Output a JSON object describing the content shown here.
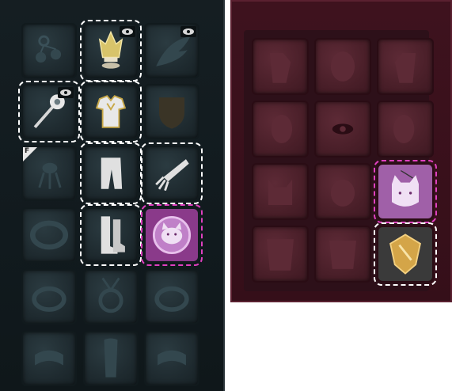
{
  "left_inventory": {
    "theme": "teal-stone",
    "slots": [
      {
        "id": "earring",
        "icon": "earring-icon",
        "state": "empty"
      },
      {
        "id": "crown",
        "icon": "crown-icon",
        "state": "equipped",
        "badge": "eye-icon"
      },
      {
        "id": "wing",
        "icon": "wing-icon",
        "state": "empty",
        "badge": "eye-icon"
      },
      {
        "id": "staff",
        "icon": "staff-icon",
        "state": "equipped",
        "badge": "eye-icon"
      },
      {
        "id": "armor",
        "icon": "armor-icon",
        "state": "equipped"
      },
      {
        "id": "shield",
        "icon": "shield-icon",
        "state": "empty"
      },
      {
        "id": "tool",
        "icon": "tool-icon",
        "state": "empty",
        "badge_text": "F"
      },
      {
        "id": "pants",
        "icon": "pants-icon",
        "state": "equipped"
      },
      {
        "id": "gauntlet",
        "icon": "gauntlet-icon",
        "state": "equipped"
      },
      {
        "id": "belt",
        "icon": "belt-icon",
        "state": "empty"
      },
      {
        "id": "boots",
        "icon": "boots-icon",
        "state": "equipped"
      },
      {
        "id": "cat-pendant",
        "icon": "cat-face-icon",
        "state": "highlighted"
      },
      {
        "id": "ring-1",
        "icon": "ring-icon",
        "state": "empty"
      },
      {
        "id": "amulet",
        "icon": "amulet-icon",
        "state": "empty"
      },
      {
        "id": "ring-2",
        "icon": "ring-icon",
        "state": "empty"
      },
      {
        "id": "bracelet-1",
        "icon": "bracelet-icon",
        "state": "empty"
      },
      {
        "id": "cape",
        "icon": "cape-icon",
        "state": "empty"
      },
      {
        "id": "bracelet-2",
        "icon": "bracelet-icon",
        "state": "empty"
      }
    ]
  },
  "right_inventory": {
    "theme": "wine-red",
    "slots": [
      {
        "id": "shoulder-left",
        "icon": "shoulder-icon",
        "state": "empty"
      },
      {
        "id": "hair",
        "icon": "hair-icon",
        "state": "empty"
      },
      {
        "id": "shoulder-right",
        "icon": "shoulder-icon",
        "state": "empty"
      },
      {
        "id": "head-left",
        "icon": "head-icon",
        "state": "empty"
      },
      {
        "id": "eye",
        "icon": "eye-icon",
        "state": "empty"
      },
      {
        "id": "head-right",
        "icon": "head-icon",
        "state": "empty"
      },
      {
        "id": "cat-mask",
        "icon": "cat-mask-icon",
        "state": "empty"
      },
      {
        "id": "face",
        "icon": "face-icon",
        "state": "empty"
      },
      {
        "id": "cat-pendant",
        "icon": "cat-face-icon",
        "state": "highlighted"
      },
      {
        "id": "torso",
        "icon": "torso-icon",
        "state": "empty"
      },
      {
        "id": "body",
        "icon": "body-icon",
        "state": "empty"
      },
      {
        "id": "golden-shield",
        "icon": "golden-shield-icon",
        "state": "equipped"
      }
    ]
  },
  "colors": {
    "selection_white": "#ffffff",
    "selection_pink": "#e040c0",
    "accent_pink": "#b86ab8",
    "gold": "#d4a548"
  }
}
